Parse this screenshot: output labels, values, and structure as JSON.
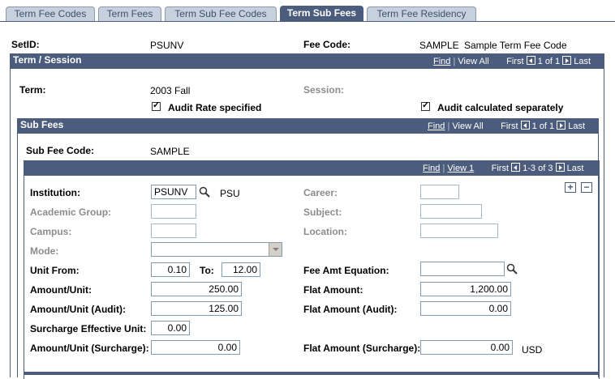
{
  "tabs": [
    {
      "label": "Term Fee Codes"
    },
    {
      "label": "Term Fees"
    },
    {
      "label": "Term Sub Fee Codes"
    },
    {
      "label": "Term Sub Fees"
    },
    {
      "label": "Term Fee Residency"
    }
  ],
  "header": {
    "setid_label": "SetID:",
    "setid_value": "PSUNV",
    "feecode_label": "Fee Code:",
    "feecode_value": "SAMPLE",
    "feecode_desc": "Sample Term Fee Code"
  },
  "term_section": {
    "title": "Term / Session",
    "nav": {
      "find": "Find",
      "view_all": "View All",
      "first": "First",
      "count": "1 of 1",
      "last": "Last"
    },
    "term_label": "Term:",
    "term_value": "2003 Fall",
    "session_label": "Session:",
    "audit_rate_label": "Audit Rate specified",
    "audit_calc_label": "Audit calculated separately"
  },
  "subfees_section": {
    "title": "Sub Fees",
    "nav": {
      "find": "Find",
      "view_all": "View All",
      "first": "First",
      "count": "1 of 1",
      "last": "Last"
    },
    "subfee_code_label": "Sub Fee Code:",
    "subfee_code_value": "SAMPLE"
  },
  "detail_section": {
    "nav": {
      "find": "Find",
      "view": "View 1",
      "first": "First",
      "count": "1-3 of 3",
      "last": "Last"
    },
    "institution_label": "Institution:",
    "institution_value": "PSUNV",
    "institution_desc": "PSU",
    "career_label": "Career:",
    "academic_group_label": "Academic Group:",
    "subject_label": "Subject:",
    "campus_label": "Campus:",
    "location_label": "Location:",
    "mode_label": "Mode:",
    "unit_from_label": "Unit From:",
    "unit_from_value": "0.10",
    "to_label": "To:",
    "unit_to_value": "12.00",
    "fee_amt_eq_label": "Fee Amt Equation:",
    "amount_unit_label": "Amount/Unit:",
    "amount_unit_value": "250.00",
    "flat_amount_label": "Flat Amount:",
    "flat_amount_value": "1,200.00",
    "amount_unit_audit_label": "Amount/Unit (Audit):",
    "amount_unit_audit_value": "125.00",
    "flat_amount_audit_label": "Flat Amount (Audit):",
    "flat_amount_audit_value": "0.00",
    "surcharge_eff_unit_label": "Surcharge Effective Unit:",
    "surcharge_eff_unit_value": "0.00",
    "amount_unit_surcharge_label": "Amount/Unit (Surcharge):",
    "amount_unit_surcharge_value": "0.00",
    "flat_amount_surcharge_label": "Flat Amount (Surcharge):",
    "flat_amount_surcharge_value": "0.00",
    "currency": "USD"
  },
  "colors": {
    "accent": "#4b5c7d",
    "tab_inactive": "#c6d1dd"
  }
}
